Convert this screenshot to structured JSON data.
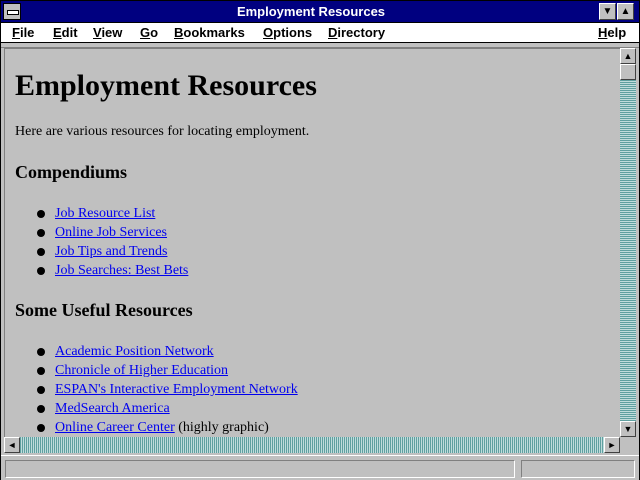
{
  "window": {
    "title": "Employment Resources",
    "minimize_glyph": "▼",
    "maximize_glyph": "▲"
  },
  "menu": {
    "items": [
      "File",
      "Edit",
      "View",
      "Go",
      "Bookmarks",
      "Options",
      "Directory"
    ],
    "help": "Help"
  },
  "page": {
    "heading": "Employment Resources",
    "intro": "Here are various resources for locating employment.",
    "sections": [
      {
        "heading": "Compendiums",
        "links": [
          {
            "text": "Job Resource List"
          },
          {
            "text": "Online Job Services"
          },
          {
            "text": "Job Tips and Trends"
          },
          {
            "text": "Job Searches: Best Bets"
          }
        ]
      },
      {
        "heading": "Some Useful Resources",
        "links": [
          {
            "text": "Academic Position Network"
          },
          {
            "text": "Chronicle of Higher Education"
          },
          {
            "text": "ESPAN's Interactive Employment Network"
          },
          {
            "text": "MedSearch America"
          },
          {
            "text": "Online Career Center",
            "note": " (highly graphic)"
          }
        ]
      }
    ]
  },
  "scrollbars": {
    "up_glyph": "▲",
    "down_glyph": "▼",
    "left_glyph": "◄",
    "right_glyph": "►"
  },
  "colors": {
    "titlebar": "#000080",
    "background": "#c0c0c0",
    "link": "#0000ee",
    "scroll_track": "#008080"
  }
}
